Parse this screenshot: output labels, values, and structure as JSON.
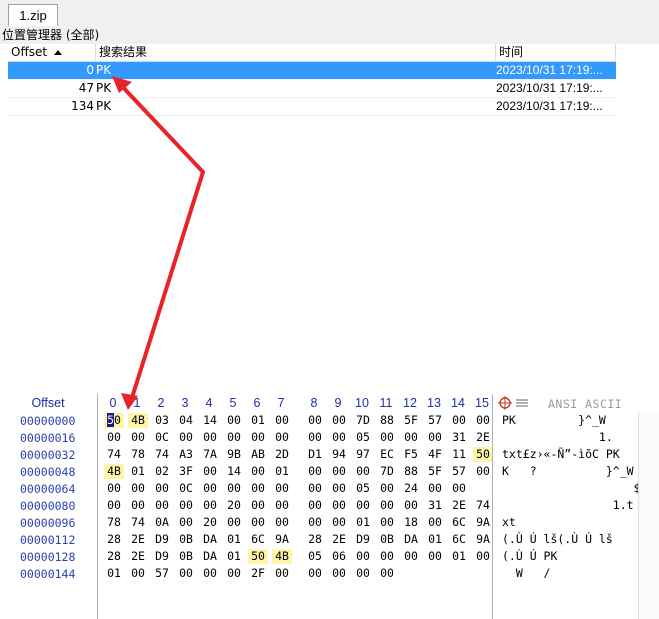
{
  "tab": {
    "label": "1.zip"
  },
  "panel": {
    "title": "位置管理器 (全部)"
  },
  "list": {
    "columns": {
      "offset": "Offset",
      "result": "搜索结果",
      "time": "时间"
    },
    "rows": [
      {
        "offset": "0",
        "result": "PK",
        "time": "2023/10/31   17:19:...",
        "selected": true
      },
      {
        "offset": "47",
        "result": "PK",
        "time": "2023/10/31   17:19:...",
        "selected": false
      },
      {
        "offset": "134",
        "result": "PK",
        "time": "2023/10/31   17:19:...",
        "selected": false
      }
    ]
  },
  "hex": {
    "offset_header": "Offset",
    "ascii_header": "ANSI ASCII",
    "columns": [
      "0",
      "1",
      "2",
      "3",
      "4",
      "5",
      "6",
      "7",
      "8",
      "9",
      "10",
      "11",
      "12",
      "13",
      "14",
      "15"
    ],
    "offsets": [
      "00000000",
      "00000016",
      "00000032",
      "00000048",
      "00000064",
      "00000080",
      "00000096",
      "00000112",
      "00000128",
      "00000144"
    ],
    "rows": [
      [
        "50",
        "4B",
        "03",
        "04",
        "14",
        "00",
        "01",
        "00",
        "00",
        "00",
        "7D",
        "88",
        "5F",
        "57",
        "00",
        "00"
      ],
      [
        "00",
        "00",
        "0C",
        "00",
        "00",
        "00",
        "00",
        "00",
        "00",
        "00",
        "05",
        "00",
        "00",
        "00",
        "31",
        "2E"
      ],
      [
        "74",
        "78",
        "74",
        "A3",
        "7A",
        "9B",
        "AB",
        "2D",
        "D1",
        "94",
        "97",
        "EC",
        "F5",
        "4F",
        "11",
        "50"
      ],
      [
        "4B",
        "01",
        "02",
        "3F",
        "00",
        "14",
        "00",
        "01",
        "00",
        "00",
        "00",
        "7D",
        "88",
        "5F",
        "57",
        "00"
      ],
      [
        "00",
        "00",
        "00",
        "0C",
        "00",
        "00",
        "00",
        "00",
        "00",
        "00",
        "05",
        "00",
        "24",
        "00",
        "00",
        ""
      ],
      [
        "00",
        "00",
        "00",
        "00",
        "00",
        "20",
        "00",
        "00",
        "00",
        "00",
        "00",
        "00",
        "00",
        "31",
        "2E",
        "74"
      ],
      [
        "78",
        "74",
        "0A",
        "00",
        "20",
        "00",
        "00",
        "00",
        "00",
        "00",
        "01",
        "00",
        "18",
        "00",
        "6C",
        "9A"
      ],
      [
        "28",
        "2E",
        "D9",
        "0B",
        "DA",
        "01",
        "6C",
        "9A",
        "28",
        "2E",
        "D9",
        "0B",
        "DA",
        "01",
        "6C",
        "9A"
      ],
      [
        "28",
        "2E",
        "D9",
        "0B",
        "DA",
        "01",
        "50",
        "4B",
        "05",
        "06",
        "00",
        "00",
        "00",
        "00",
        "01",
        "00"
      ],
      [
        "01",
        "00",
        "57",
        "00",
        "00",
        "00",
        "2F",
        "00",
        "00",
        "00",
        "00",
        "00",
        "",
        "",
        "",
        ""
      ]
    ],
    "ascii": [
      "PK         }^_W",
      "              1.",
      "txt£z›«-Ñ”-ìõC PK",
      "K   ?          }^_W",
      "                   $",
      "                1.t",
      "xt                  lš",
      "(.Ù Ú lš(.Ù Ú lš",
      "(.Ù Ú PK",
      "  W   /"
    ]
  },
  "colors": {
    "selection": "#3399ff",
    "highlight": "#fff5a8",
    "arrow": "#e8242a",
    "offset_blue": "#2a3fb0"
  },
  "icons": {
    "ascii_toolbar": "crosshair-icon",
    "list_toggle": "list-lines-icon",
    "sort": "sort-up-icon"
  }
}
